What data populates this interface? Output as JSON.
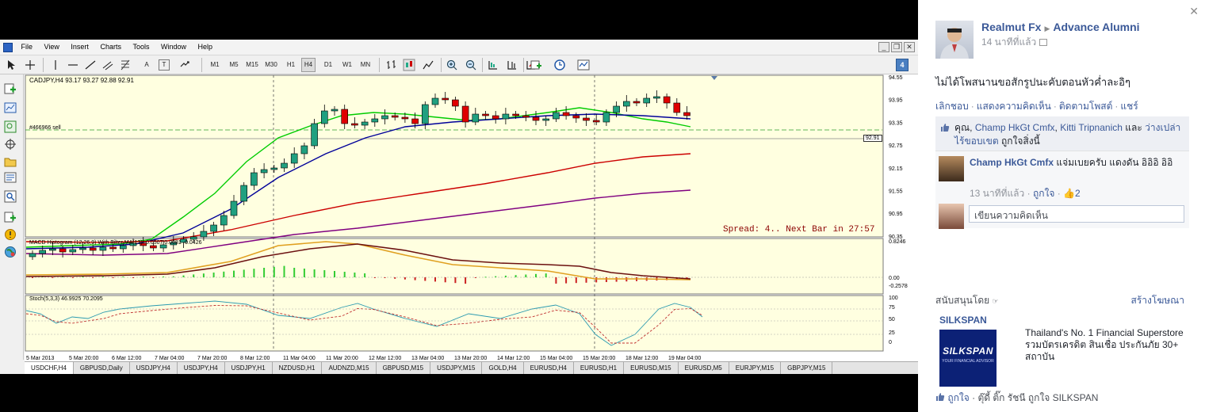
{
  "platform": {
    "menu": [
      "File",
      "View",
      "Insert",
      "Charts",
      "Tools",
      "Window",
      "Help"
    ],
    "timeframes": [
      "M1",
      "M5",
      "M15",
      "M30",
      "H1",
      "H4",
      "D1",
      "W1",
      "MN"
    ],
    "active_timeframe": "H4",
    "toolbar_letters": {
      "text_tool": "A",
      "text_label_tool": "T"
    },
    "toolbar_badge": "4",
    "sidebar_icons": [
      "new-order-icon",
      "chart-icon",
      "zoom-icon",
      "crosshair-icon",
      "folder-icon",
      "navigator-icon",
      "search-icon",
      "add-icon",
      "alert-icon",
      "world-icon"
    ]
  },
  "chart": {
    "header": "CADJPY,H4  93.17 93.27 92.88 92.91",
    "order_label": "#466966 sell",
    "current_price": "92.91",
    "spread_text": "Spread: 4.. Next Bar in 27:57",
    "main_price_labels": [
      "94.55",
      "93.95",
      "93.35",
      "92.75",
      "92.15",
      "91.55",
      "90.95",
      "90.35"
    ],
    "macd_header": "MACD Histogram (12,26,9) With Filter MA(13) -0.0507 0.0081 -0.0426",
    "macd_labels": [
      "0.8246",
      "0.00",
      "-0.2578"
    ],
    "stoch_header": "Stoch(5,3,3) 46.9925 70.2095",
    "stoch_labels": [
      "100",
      "75",
      "50",
      "25",
      "0"
    ],
    "time_labels": [
      "5 Mar 2013",
      "5 Mar 20:00",
      "6 Mar 12:00",
      "7 Mar 04:00",
      "7 Mar 20:00",
      "8 Mar 12:00",
      "11 Mar 04:00",
      "11 Mar 20:00",
      "12 Mar 12:00",
      "13 Mar 04:00",
      "13 Mar 20:00",
      "14 Mar 12:00",
      "15 Mar 04:00",
      "15 Mar 20:00",
      "18 Mar 12:00",
      "19 Mar 04:00"
    ],
    "colors": {
      "background": "#ffffe0",
      "bull": "#20a080",
      "bear": "#e00000",
      "ma_fast": "#00cc00",
      "ma_mid": "#000099",
      "ma_slow": "#cc0000",
      "ma_long": "#800080",
      "macd_signal": "#e0a020",
      "macd_main": "#6b1010"
    }
  },
  "tabs": [
    "USDCHF,H4",
    "GBPUSD,Daily",
    "USDJPY,H4",
    "USDJPY,H4",
    "USDJPY,H1",
    "NZDUSD,H1",
    "AUDNZD,M15",
    "GBPUSD,M15",
    "USDJPY,M15",
    "GOLD,H4",
    "EURUSD,H4",
    "EURUSD,H1",
    "EURUSD,M15",
    "EURUSD,M5",
    "EURJPY,M15",
    "GBPJPY,M15"
  ],
  "facebook": {
    "author": "Realmut Fx",
    "group": "Advance Alumni",
    "time": "14 นาทีที่แล้ว",
    "post_text": "ไม่ได้โพสนานขอสักรูปนะคับตอนหัวค่ำละอิๆ",
    "actions": [
      "เลิกชอบ",
      "แสดงความคิดเห็น",
      "ติดตามโพสต์",
      "แชร์"
    ],
    "likes": {
      "prefix": "คุณ,",
      "names": [
        "Champ HkGt Cmfx",
        "Kitti Tripnanich"
      ],
      "and": "และ",
      "others": "ว่างเปล่า ไร้ขอบเขต",
      "suffix": "ถูกใจสิ่งนี้"
    },
    "comment": {
      "author": "Champ HkGt Cmfx",
      "text": "แจ่มเบยครับ แดงดัน อิอิอิ อิอิ",
      "time": "13 นาทีที่แล้ว",
      "like_label": "ถูกใจ",
      "like_count": "2"
    },
    "comment_placeholder": "เขียนความคิดเห็น",
    "sponsored_label": "สนับสนุนโดย",
    "create_ad": "สร้างโฆษณา",
    "ad": {
      "title": "SILKSPAN",
      "logo_text": "SILKSPAN",
      "logo_sub": "YOUR FINANCIAL ADVISOR",
      "text": "Thailand's No. 1 Financial Superstore รวมบัตรเครดิต สินเชื่อ ประกันภัย 30+ สถาบัน",
      "like_label": "ถูกใจ",
      "social": "ตุ๊ดี้ ติ๊ก รัชนี ถูกใจ SILKSPAN"
    }
  }
}
